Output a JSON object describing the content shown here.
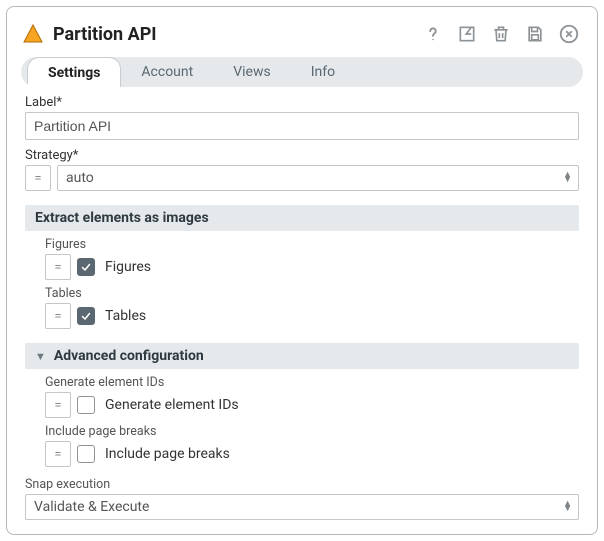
{
  "header": {
    "title": "Partition API"
  },
  "tabs": {
    "list": [
      {
        "label": "Settings",
        "active": true
      },
      {
        "label": "Account",
        "active": false
      },
      {
        "label": "Views",
        "active": false
      },
      {
        "label": "Info",
        "active": false
      }
    ]
  },
  "form": {
    "label_field_label": "Label*",
    "label_field_value": "Partition API",
    "strategy_label": "Strategy*",
    "strategy_value": "auto",
    "extract_header": "Extract elements as images",
    "figures_label": "Figures",
    "figures_cb_label": "Figures",
    "figures_checked": true,
    "tables_label": "Tables",
    "tables_cb_label": "Tables",
    "tables_checked": true,
    "advanced_header": "Advanced configuration",
    "gen_ids_label": "Generate element IDs",
    "gen_ids_cb_label": "Generate element IDs",
    "gen_ids_checked": false,
    "page_breaks_label": "Include page breaks",
    "page_breaks_cb_label": "Include page breaks",
    "page_breaks_checked": false,
    "snap_label": "Snap execution",
    "snap_value": "Validate & Execute"
  },
  "glyphs": {
    "equals": "="
  }
}
